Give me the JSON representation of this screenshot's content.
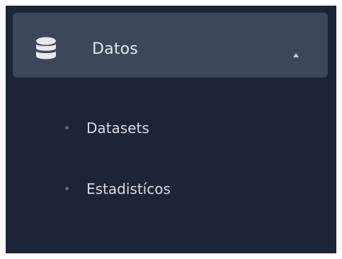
{
  "menu": {
    "header": {
      "icon": "database-icon",
      "label": "Datos",
      "expanded": true,
      "chevron": "chevron-up-icon"
    },
    "items": [
      {
        "label": "Datasets",
        "icon": "bullet-icon"
      },
      {
        "label": "Estadistícos",
        "icon": "bullet-icon"
      }
    ]
  },
  "colors": {
    "background": "#1c2437",
    "header_background": "#3c475a",
    "text": "#d7dce5",
    "bullet": "#5f6b80"
  }
}
